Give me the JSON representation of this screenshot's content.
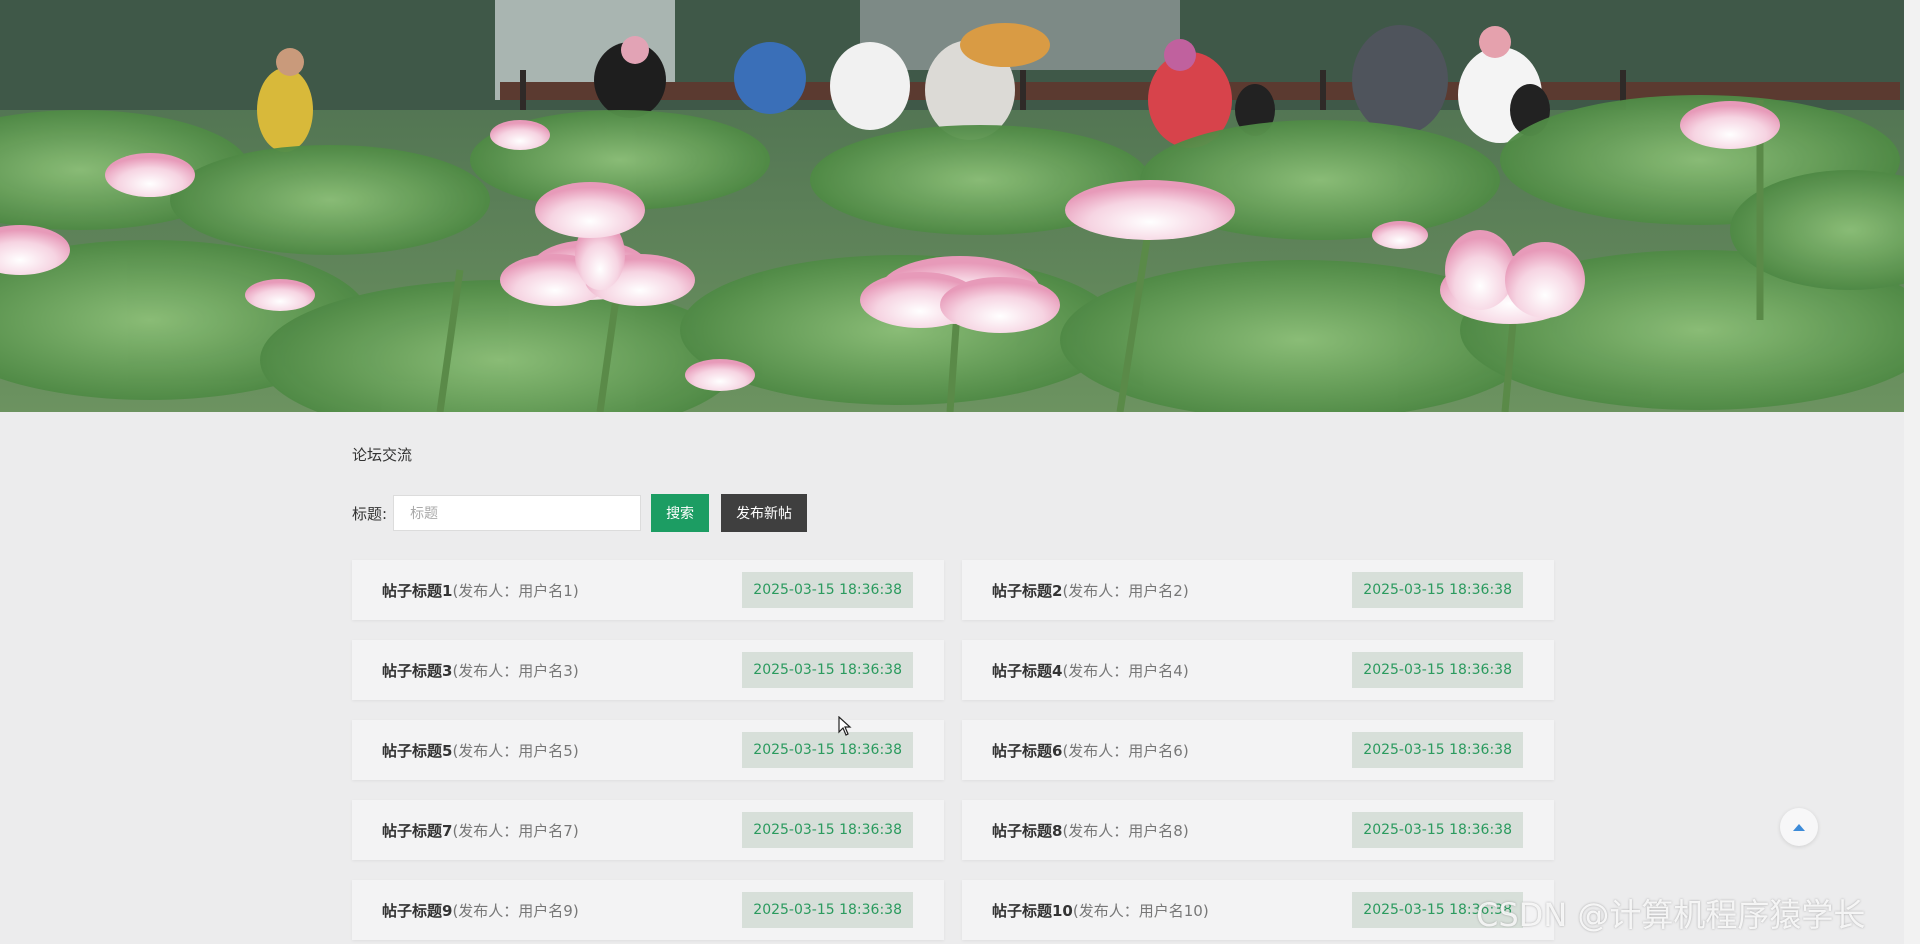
{
  "banner": {
    "description_icon": "lotus-pond-photo"
  },
  "forum": {
    "section_title": "论坛交流",
    "search_label": "标题:",
    "search_placeholder": "标题",
    "search_value": "",
    "search_button": "搜索",
    "post_button": "发布新帖"
  },
  "posts": [
    {
      "title": "帖子标题1",
      "author": "(发布人：用户名1)",
      "date": "2025-03-15 18:36:38"
    },
    {
      "title": "帖子标题2",
      "author": "(发布人：用户名2)",
      "date": "2025-03-15 18:36:38"
    },
    {
      "title": "帖子标题3",
      "author": "(发布人：用户名3)",
      "date": "2025-03-15 18:36:38"
    },
    {
      "title": "帖子标题4",
      "author": "(发布人：用户名4)",
      "date": "2025-03-15 18:36:38"
    },
    {
      "title": "帖子标题5",
      "author": "(发布人：用户名5)",
      "date": "2025-03-15 18:36:38"
    },
    {
      "title": "帖子标题6",
      "author": "(发布人：用户名6)",
      "date": "2025-03-15 18:36:38"
    },
    {
      "title": "帖子标题7",
      "author": "(发布人：用户名7)",
      "date": "2025-03-15 18:36:38"
    },
    {
      "title": "帖子标题8",
      "author": "(发布人：用户名8)",
      "date": "2025-03-15 18:36:38"
    },
    {
      "title": "帖子标题9",
      "author": "(发布人：用户名9)",
      "date": "2025-03-15 18:36:38"
    },
    {
      "title": "帖子标题10",
      "author": "(发布人：用户名10)",
      "date": "2025-03-15 18:36:38"
    }
  ],
  "back_to_top_icon": "chevron-up-icon",
  "watermark": "CSDN @计算机程序猿学长",
  "colors": {
    "search_button": "#1c9d63",
    "post_button": "#3f3f3f",
    "date_text": "#2a9a5e",
    "date_bg": "#d7dfd9",
    "page_bg": "#ececed"
  }
}
